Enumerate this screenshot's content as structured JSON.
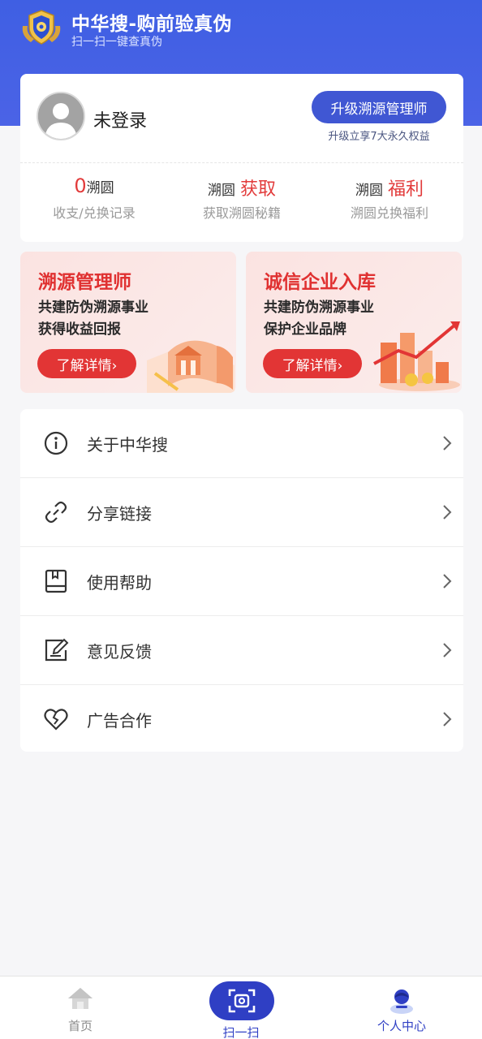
{
  "header": {
    "title": "中华搜-购前验真伪",
    "subtitle": "扫一扫一键查真伪",
    "logo_icon": "shield-badge-logo"
  },
  "profile": {
    "username": "未登录",
    "upgrade_button": "升级溯源管理师",
    "upgrade_note": "升级立享7大永久权益",
    "stats": [
      {
        "prefix": "0",
        "suffix": "溯圆",
        "desc": "收支/兑换记录"
      },
      {
        "prefix": "溯圆",
        "suffix": "获取",
        "desc": "获取溯圆秘籍"
      },
      {
        "prefix": "溯圆",
        "suffix": "福利",
        "desc": "溯圆兑换福利"
      }
    ]
  },
  "promos": [
    {
      "title": "溯源管理师",
      "line1": "共建防伪溯源事业",
      "line2": "获得收益回报",
      "button": "了解详情›"
    },
    {
      "title": "诚信企业入库",
      "line1": "共建防伪溯源事业",
      "line2": "保护企业品牌",
      "button": "了解详情›"
    }
  ],
  "menu": [
    {
      "label": "关于中华搜",
      "icon": "info-icon"
    },
    {
      "label": "分享链接",
      "icon": "link-icon"
    },
    {
      "label": "使用帮助",
      "icon": "help-book-icon"
    },
    {
      "label": "意见反馈",
      "icon": "feedback-edit-icon"
    },
    {
      "label": "广告合作",
      "icon": "broken-heart-icon"
    }
  ],
  "tabbar": {
    "home": "首页",
    "scan": "扫一扫",
    "profile": "个人中心"
  },
  "colors": {
    "primary": "#4057d3",
    "header": "#4560e4",
    "accent_red": "#e23535",
    "active_tab": "#2f3fc4"
  }
}
